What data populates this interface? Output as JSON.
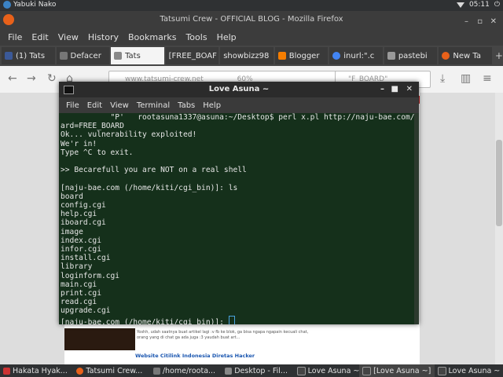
{
  "panel": {
    "user": "Yabuki Nako",
    "time": "05:11"
  },
  "firefox": {
    "title": "Tatsumi Crew - OFFICIAL BLOG - Mozilla Firefox",
    "menu": [
      "File",
      "Edit",
      "View",
      "History",
      "Bookmarks",
      "Tools",
      "Help"
    ],
    "tabs": [
      {
        "label": "(1) Tats",
        "color": "#3b5998"
      },
      {
        "label": "Defacer",
        "color": "#777777"
      },
      {
        "label": "Tats",
        "color": "#888888"
      },
      {
        "label": "[FREE_BOAF",
        "color": "#555555"
      },
      {
        "label": "showbizz98",
        "color": "#666666"
      },
      {
        "label": "Blogger",
        "color": "#f57d00"
      },
      {
        "label": "inurl:\".c",
        "color": "#4285f4"
      },
      {
        "label": "pastebi",
        "color": "#999999"
      },
      {
        "label": "New Ta",
        "color": "#e8611a"
      }
    ],
    "url": "www.tatsumi-crew.net",
    "zoom": "60%",
    "search": "\"F_BOARD\""
  },
  "page": {
    "post1_text": "Yoshh, udah saatnya buat artikel lagi :v fb ke blok, ga bisa ngapa ngapain kecuali chat, orang yang di chat ga ada juga :3 yaudah buat art...",
    "post2_title": "Website Citilink Indonesia Diretas Hacker"
  },
  "terminal": {
    "title": "Love Asuna ~",
    "menu": [
      "File",
      "Edit",
      "View",
      "Terminal",
      "Tabs",
      "Help"
    ],
    "lines": [
      "           \"P'   rootasuna1337@asuna:~/Desktop$ perl x.pl http://naju-bae.com/",
      "ard=FREE_BOARD",
      "Ok... vulnerability exploited!",
      "We'r in!",
      "Type ^C to exit.",
      "",
      ">> Becarefull you are NOT on a real shell",
      "",
      "[naju-bae.com (/home/kiti/cgi_bin)]: ls",
      "board",
      "config.cgi",
      "help.cgi",
      "iboard.cgi",
      "image",
      "index.cgi",
      "infor.cgi",
      "install.cgi",
      "library",
      "loginform.cgi",
      "main.cgi",
      "print.cgi",
      "read.cgi",
      "upgrade.cgi"
    ],
    "prompt": "[naju-bae.com (/home/kiti/cgi_bin)]: "
  },
  "taskbar": [
    {
      "label": "Hakata Hyak...",
      "color": "#cc3333"
    },
    {
      "label": "Tatsumi Crew...",
      "color": "#e8611a"
    },
    {
      "label": "/home/roota...",
      "color": "#777777"
    },
    {
      "label": "Desktop - Fil...",
      "color": "#888888"
    },
    {
      "label": "Love Asuna ~",
      "color": "#444444"
    },
    {
      "label": "[Love Asuna ~]",
      "color": "#444444"
    },
    {
      "label": "Love Asuna ~",
      "color": "#444444"
    }
  ]
}
